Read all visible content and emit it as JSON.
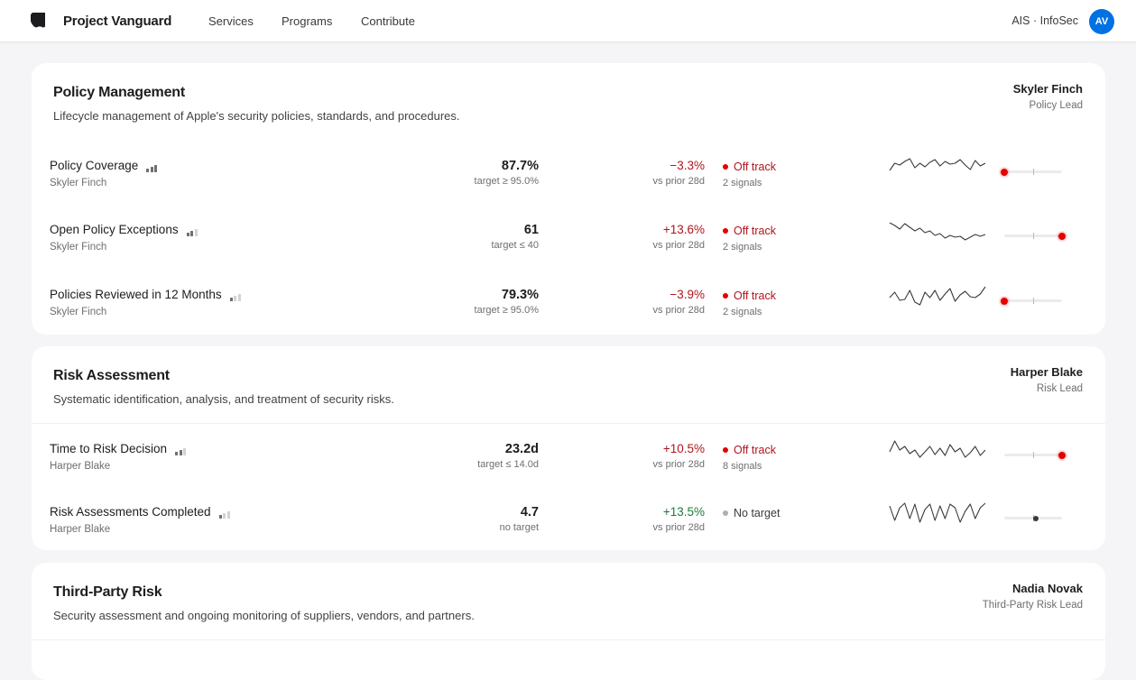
{
  "header": {
    "brand": "Project Vanguard",
    "nav": [
      "Services",
      "Programs",
      "Contribute"
    ],
    "org": "AIS · InfoSec",
    "avatar": "AV",
    "accent_color": "#0071e3"
  },
  "colors": {
    "off_track": "#b0141c",
    "positive": "#1b7a3a",
    "muted": "#6e6e73"
  },
  "sections": [
    {
      "title": "Policy Management",
      "description": "Lifecycle management of Apple's security policies, standards, and procedures.",
      "owner_name": "Skyler Finch",
      "owner_role": "Policy Lead",
      "metrics": [
        {
          "name": "Policy Coverage",
          "quality_bars": 3,
          "owner": "Skyler Finch",
          "value": "87.7%",
          "target": "target ≥ 95.0%",
          "delta": "−3.3%",
          "delta_dir": "neg",
          "vs": "vs prior 28d",
          "status": "Off track",
          "status_kind": "off",
          "signals": "2 signals",
          "position": 0.0,
          "spark": [
            12,
            20,
            18,
            22,
            25,
            15,
            20,
            16,
            21,
            24,
            17,
            22,
            19,
            20,
            24,
            18,
            13,
            23,
            17,
            20
          ]
        },
        {
          "name": "Open Policy Exceptions",
          "quality_bars": 2,
          "owner": "Skyler Finch",
          "value": "61",
          "target": "target ≤ 40",
          "delta": "+13.6%",
          "delta_dir": "neg",
          "vs": "vs prior 28d",
          "status": "Off track",
          "status_kind": "off",
          "signals": "2 signals",
          "position": 1.0,
          "spark": [
            25,
            22,
            18,
            24,
            20,
            16,
            19,
            14,
            16,
            11,
            13,
            8,
            11,
            9,
            10,
            6,
            9,
            12,
            10,
            12
          ]
        },
        {
          "name": "Policies Reviewed in 12 Months",
          "quality_bars": 1,
          "owner": "Skyler Finch",
          "value": "79.3%",
          "target": "target ≥ 95.0%",
          "delta": "−3.9%",
          "delta_dir": "neg",
          "vs": "vs prior 28d",
          "status": "Off track",
          "status_kind": "off",
          "signals": "2 signals",
          "position": 0.0,
          "spark": [
            14,
            20,
            11,
            12,
            22,
            9,
            6,
            20,
            14,
            22,
            11,
            18,
            24,
            10,
            17,
            21,
            15,
            14,
            18,
            26
          ]
        }
      ]
    },
    {
      "title": "Risk Assessment",
      "description": "Systematic identification, analysis, and treatment of security risks.",
      "owner_name": "Harper Blake",
      "owner_role": "Risk Lead",
      "metrics": [
        {
          "name": "Time to Risk Decision",
          "quality_bars": 2,
          "owner": "Harper Blake",
          "value": "23.2d",
          "target": "target ≤ 14.0d",
          "delta": "+10.5%",
          "delta_dir": "neg",
          "vs": "vs prior 28d",
          "status": "Off track",
          "status_kind": "off",
          "signals": "8 signals",
          "position": 1.0,
          "spark": [
            14,
            26,
            16,
            20,
            12,
            16,
            8,
            14,
            20,
            11,
            18,
            10,
            22,
            14,
            18,
            8,
            13,
            20,
            10,
            16
          ]
        },
        {
          "name": "Risk Assessments Completed",
          "quality_bars": 1,
          "owner": "Harper Blake",
          "value": "4.7",
          "target": "no target",
          "delta": "+13.5%",
          "delta_dir": "pos",
          "vs": "vs prior 28d",
          "status": "No target",
          "status_kind": "none",
          "signals": "",
          "position": 0.55,
          "spark": [
            24,
            8,
            22,
            27,
            10,
            26,
            6,
            20,
            26,
            8,
            24,
            10,
            26,
            22,
            6,
            18,
            26,
            10,
            22,
            27
          ]
        }
      ]
    },
    {
      "title": "Third-Party Risk",
      "description": "Security assessment and ongoing monitoring of suppliers, vendors, and partners.",
      "owner_name": "Nadia Novak",
      "owner_role": "Third-Party Risk Lead",
      "metrics": []
    }
  ]
}
